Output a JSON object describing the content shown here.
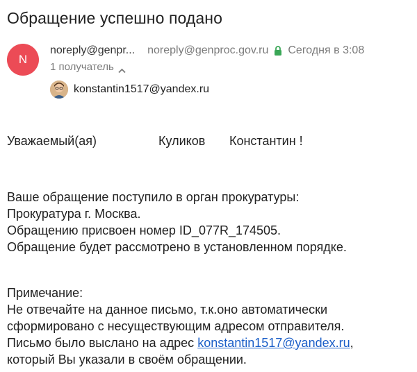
{
  "email": {
    "subject": "Обращение успешно подано",
    "sender_initial": "N",
    "sender_name": "noreply@genpr...",
    "sender_email": "noreply@genproc.gov.ru",
    "date": "Сегодня в 3:08",
    "recipients_count": "1 получатель",
    "recipient_email": "konstantin1517@yandex.ru"
  },
  "body": {
    "greeting": "Уважаемый(ая)",
    "last_name": "Куликов",
    "first_name": "Константин !",
    "line1": "Ваше обращение поступило в орган прокуратуры:",
    "line2": "Прокуратура г. Москва.",
    "line3": "Обращению присвоен номер ID_077R_174505.",
    "line4": "Обращение будет рассмотрено в установленном порядке.",
    "note_label": "Примечание:",
    "note1": "Не отвечайте на данное письмо, т.к.оно автоматически",
    "note2": "сформировано с несуществующим адресом отправителя.",
    "note3_prefix": "Письмо было выслано на адрес ",
    "note3_link": "konstantin1517@yandex.ru",
    "note3_suffix": ",",
    "note4": "который Вы указали в своём обращении."
  },
  "colors": {
    "avatar_bg": "#ec4b56",
    "lock": "#3aa757",
    "link": "#1a5ec8",
    "muted": "#7a7a7a"
  },
  "icons": [
    "lock-icon",
    "chevron-up-icon",
    "recipient-avatar"
  ]
}
